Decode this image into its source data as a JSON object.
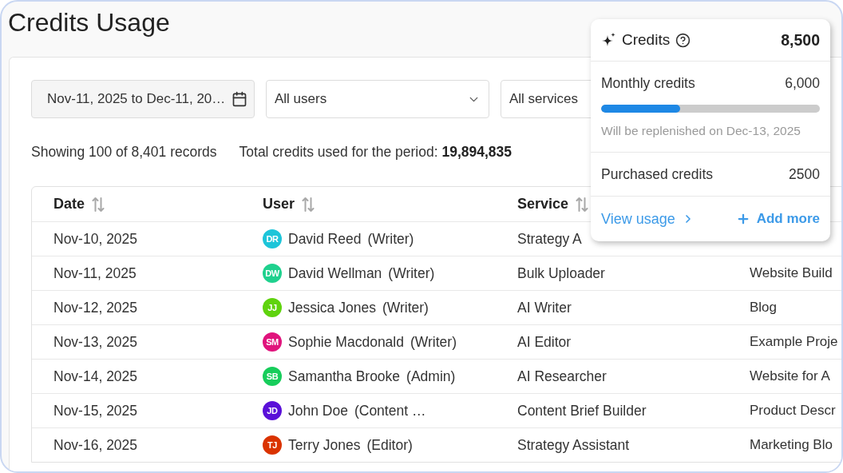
{
  "page": {
    "title": "Credits Usage"
  },
  "filters": {
    "date_range": {
      "value": "Nov-11, 2025 to Dec-11, 20…"
    },
    "user_select": {
      "value": "All users"
    },
    "service_select": {
      "value": "All services"
    }
  },
  "summary": {
    "records": "Showing 100 of 8,401 records",
    "total": "Total credits used for the period: **19,894,835**"
  },
  "table": {
    "columns": [
      {
        "label": "Date",
        "sortable": true
      },
      {
        "label": "User",
        "sortable": true
      },
      {
        "label": "Service",
        "sortable": true
      }
    ],
    "rows": [
      {
        "date": "Nov-10, 2025",
        "user": {
          "initials": "DR",
          "name": "David Reed",
          "role": "(Writer)",
          "color": "#1dc5d9"
        },
        "service": "Strategy A"
      },
      {
        "date": "Nov-11, 2025",
        "user": {
          "initials": "DW",
          "name": "David Wellman",
          "role": "(Writer)",
          "color": "#1fd18e"
        },
        "service": "Bulk Uploader",
        "column_4": "Website Build"
      },
      {
        "date": "Nov-12, 2025",
        "user": {
          "initials": "JJ",
          "name": "Jessica Jones",
          "role": "(Writer)",
          "color": "#5fd30e"
        },
        "service": "AI Writer",
        "column_4": "Blog"
      },
      {
        "date": "Nov-13, 2025",
        "user": {
          "initials": "SM",
          "name": "Sophie Macdonald",
          "role": "(Writer)",
          "color": "#e0137c"
        },
        "service": "AI Editor",
        "column_4": "Example Proje"
      },
      {
        "date": "Nov-14, 2025",
        "user": {
          "initials": "SB",
          "name": "Samantha Brooke",
          "role": "(Admin)",
          "color": "#17cd5b"
        },
        "service": "AI Researcher",
        "column_4": "Website for A"
      },
      {
        "date": "Nov-15, 2025",
        "user": {
          "initials": "JD",
          "name": "John Doe",
          "role": "(Content …",
          "color": "#5a10d8"
        },
        "service": "Content Brief Builder",
        "column_4": "Product Descr"
      },
      {
        "date": "Nov-16, 2025",
        "user": {
          "initials": "TJ",
          "name": "Terry Jones",
          "role": "(Editor)",
          "color": "#da3300"
        },
        "service": "Strategy Assistant",
        "column_4": "Marketing Blo"
      }
    ]
  },
  "credits_popover": {
    "title": "Credits",
    "total": "8,500",
    "monthly": {
      "label": "Monthly credits",
      "value": "6,000",
      "level": 0.36,
      "note": "Will be replenished on Dec-13, 2025"
    },
    "purchased": {
      "label": "Purchased credits",
      "value": "2500"
    },
    "actions": [
      {
        "kind": "link",
        "label": "View usage"
      },
      {
        "kind": "add",
        "label": "Add more"
      }
    ]
  }
}
